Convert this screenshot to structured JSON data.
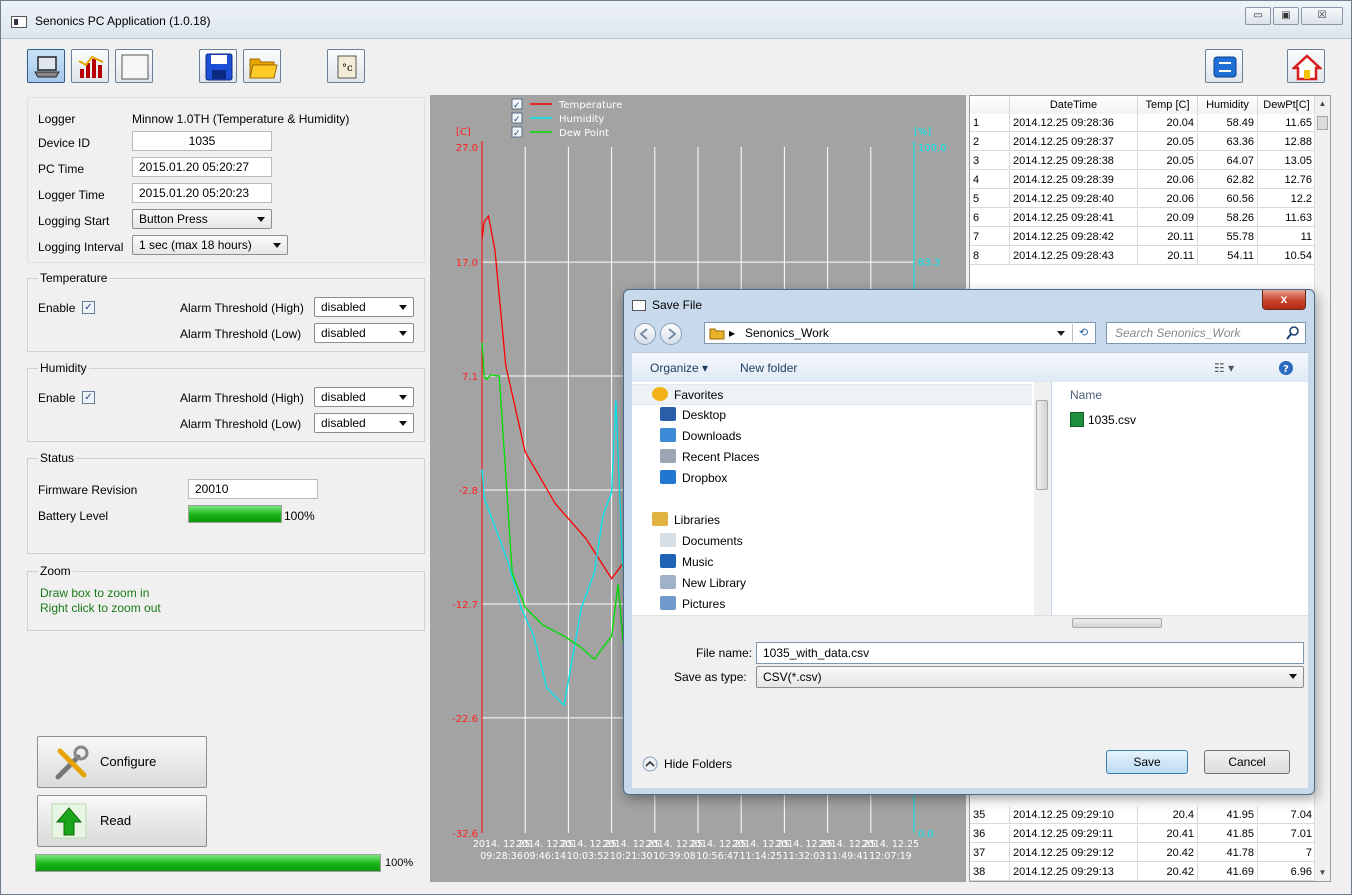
{
  "window": {
    "title": "Senonics PC Application (1.0.18)",
    "minimize": "▭",
    "maximize": "▣",
    "close": "☒"
  },
  "logger": {
    "logger_label": "Logger",
    "logger_value": "Minnow 1.0TH (Temperature & Humidity)",
    "device_id_label": "Device ID",
    "device_id_value": "1035",
    "pc_time_label": "PC Time",
    "pc_time_value": "2015.01.20 05:20:27",
    "logger_time_label": "Logger Time",
    "logger_time_value": "2015.01.20 05:20:23",
    "logging_start_label": "Logging Start",
    "logging_start_value": "Button Press",
    "logging_interval_label": "Logging Interval",
    "logging_interval_value": "1 sec (max 18 hours)"
  },
  "temperature": {
    "title": "Temperature",
    "enable_label": "Enable",
    "check": "✓",
    "high_label": "Alarm Threshold (High)",
    "high_value": "disabled",
    "low_label": "Alarm Threshold (Low)",
    "low_value": "disabled"
  },
  "humidity": {
    "title": "Humidity",
    "enable_label": "Enable",
    "check": "✓",
    "high_label": "Alarm Threshold (High)",
    "high_value": "disabled",
    "low_label": "Alarm Threshold (Low)",
    "low_value": "disabled"
  },
  "status": {
    "title": "Status",
    "firmware_label": "Firmware Revision",
    "firmware_value": "20010",
    "battery_label": "Battery Level",
    "battery_percent": 100,
    "battery_text": "100%"
  },
  "zoom": {
    "title": "Zoom",
    "line1": "Draw box to zoom in",
    "line2": "Right click to zoom out"
  },
  "buttons": {
    "configure": "Configure",
    "read": "Read"
  },
  "progress": {
    "percent": 100,
    "text": "100%"
  },
  "colors": {
    "temperature": "#ff0000",
    "humidity": "#00e5ee",
    "dewpoint": "#00dd00",
    "chart_bg": "#a3a3a3"
  },
  "chart_data": {
    "type": "line",
    "legend": [
      {
        "name": "Temperature",
        "color": "#ff0000"
      },
      {
        "name": "Humidity",
        "color": "#00e5ee"
      },
      {
        "name": "Dew Point",
        "color": "#00dd00"
      }
    ],
    "legend_check": "✓",
    "left_unit": "[C]",
    "right_unit": "[%]",
    "left_ticks": [
      "27.0",
      "17.0",
      "7.1",
      "-2.8",
      "-12.7",
      "-22.6",
      "-32.6"
    ],
    "right_ticks": [
      "100.0",
      "83.3",
      "0.0"
    ],
    "x_dates": [
      "2014. 12.25",
      "2014. 12.25",
      "2014. 12.25",
      "2014. 12.25",
      "2014. 12.25",
      "2014. 12.25",
      "2014. 12.25",
      "2014. 12.25",
      "2014. 12.25",
      "2014. 12.25"
    ],
    "x_times": [
      "09:28:36",
      "09:46:14",
      "10:03:52",
      "10:21:30",
      "10:39:08",
      "10:56:47",
      "11:14:25",
      "11:32:03",
      "11:49:41",
      "12:07:19"
    ],
    "ylim_left": [
      -32.6,
      27.0
    ],
    "ylim_right": [
      0.0,
      100.0
    ],
    "series": [
      {
        "name": "Temperature",
        "axis": "left",
        "x": [
          0,
          0.05,
          0.15,
          0.3,
          0.55,
          1.0,
          1.7,
          2.4,
          3.0,
          3.6,
          4.3,
          5.1,
          6.3,
          7.5
        ],
        "values": [
          19.0,
          20.5,
          21.0,
          18.0,
          8.0,
          0.5,
          -4.0,
          -7.0,
          -10.5,
          -7.5,
          -8.5,
          -10.5,
          -11.8,
          -12.0
        ]
      },
      {
        "name": "Humidity",
        "axis": "left",
        "x": [
          0,
          0.05,
          0.3,
          0.6,
          0.9,
          1.2,
          1.5,
          1.9,
          2.3,
          2.6,
          2.8,
          3.0,
          3.1,
          3.25,
          3.45,
          3.8,
          4.4,
          5.0,
          5.6,
          6.4,
          7.3
        ],
        "values": [
          -1.0,
          -3.5,
          -6.0,
          -9.0,
          -13.0,
          -15.5,
          -20.0,
          -21.5,
          -13.0,
          -10.0,
          -5.0,
          -3.0,
          5.0,
          -9.0,
          -15.0,
          -14.0,
          -13.5,
          -14.5,
          -13.0,
          -12.5,
          -12.0
        ]
      },
      {
        "name": "Dew Point",
        "axis": "left",
        "x": [
          0,
          0.05,
          0.1,
          0.2,
          0.4,
          0.7,
          1.0,
          1.4,
          1.9,
          2.3,
          2.6,
          2.9,
          3.0,
          3.15,
          3.4,
          3.8,
          4.4,
          5.0,
          5.6,
          6.4,
          7.3
        ],
        "values": [
          10.0,
          7.1,
          6.8,
          7.2,
          7.1,
          -10.0,
          -13.0,
          -14.5,
          -15.5,
          -16.5,
          -17.5,
          -16.0,
          -15.5,
          -11.0,
          -21.5,
          -23.0,
          -24.0,
          -25.0,
          -24.5,
          -24.0,
          -23.5
        ]
      }
    ]
  },
  "table": {
    "headers": [
      "",
      "DateTime",
      "Temp [C]",
      "Humidity",
      "DewPt[C]"
    ],
    "rows": [
      [
        "1",
        "2014.12.25  09:28:36",
        "20.04",
        "58.49",
        "11.65"
      ],
      [
        "2",
        "2014.12.25  09:28:37",
        "20.05",
        "63.36",
        "12.88"
      ],
      [
        "3",
        "2014.12.25  09:28:38",
        "20.05",
        "64.07",
        "13.05"
      ],
      [
        "4",
        "2014.12.25  09:28:39",
        "20.06",
        "62.82",
        "12.76"
      ],
      [
        "5",
        "2014.12.25  09:28:40",
        "20.06",
        "60.56",
        "12.2"
      ],
      [
        "6",
        "2014.12.25  09:28:41",
        "20.09",
        "58.26",
        "11.63"
      ],
      [
        "7",
        "2014.12.25  09:28:42",
        "20.11",
        "55.78",
        "11"
      ],
      [
        "8",
        "2014.12.25  09:28:43",
        "20.11",
        "54.11",
        "10.54"
      ]
    ],
    "bottom_rows": [
      [
        "35",
        "2014.12.25  09:29:10",
        "20.4",
        "41.95",
        "7.04"
      ],
      [
        "36",
        "2014.12.25  09:29:11",
        "20.41",
        "41.85",
        "7.01"
      ],
      [
        "37",
        "2014.12.25  09:29:12",
        "20.42",
        "41.78",
        "7"
      ],
      [
        "38",
        "2014.12.25  09:29:13",
        "20.42",
        "41.69",
        "6.96"
      ]
    ],
    "scroll_up": "▲",
    "scroll_down": "▼"
  },
  "dialog": {
    "title": "Save File",
    "close": "x",
    "path_arrow": "▸",
    "path": "Senonics_Work",
    "search_placeholder": "Search Senonics_Work",
    "organize": "Organize ▾",
    "new_folder": "New folder",
    "nav_items": [
      {
        "label": "Favorites",
        "icon": "star-icon"
      },
      {
        "label": "Desktop",
        "icon": "desktop-icon"
      },
      {
        "label": "Downloads",
        "icon": "downloads-icon"
      },
      {
        "label": "Recent Places",
        "icon": "recent-places-icon"
      },
      {
        "label": "Dropbox",
        "icon": "dropbox-icon"
      },
      {
        "label": "Libraries",
        "icon": "libraries-icon"
      },
      {
        "label": "Documents",
        "icon": "documents-icon"
      },
      {
        "label": "Music",
        "icon": "music-icon"
      },
      {
        "label": "New Library",
        "icon": "new-library-icon"
      },
      {
        "label": "Pictures",
        "icon": "pictures-icon"
      }
    ],
    "name_header": "Name",
    "files": [
      "1035.csv"
    ],
    "file_name_label": "File name:",
    "file_name_value": "1035_with_data.csv",
    "save_type_label": "Save as type:",
    "save_type_value": "CSV(*.csv)",
    "hide_folders": "Hide Folders",
    "save": "Save",
    "cancel": "Cancel"
  }
}
